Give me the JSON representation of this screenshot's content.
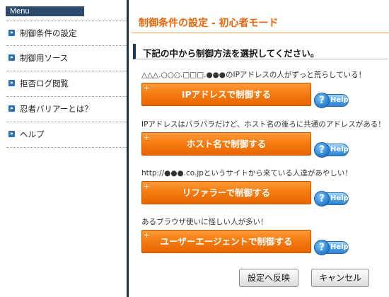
{
  "sidebar": {
    "header": "Menu",
    "items": [
      {
        "label": "制御条件の設定",
        "icon": "arrow-bullet-icon"
      },
      {
        "label": "制御用ソース",
        "icon": "arrow-bullet-icon"
      },
      {
        "label": "拒否ログ閲覧",
        "icon": "arrow-bullet-icon"
      },
      {
        "label": "忍者バリアーとは？",
        "icon": "arrow-bullet-icon"
      },
      {
        "label": "ヘルプ",
        "icon": "arrow-bullet-icon"
      }
    ]
  },
  "main": {
    "title": "制御条件の設定 - 初心者モード",
    "section_heading": "下記の中から制御方法を選択してください。",
    "options": [
      {
        "description": "△△△.○○○.□□□.●●●のIPアドレスの人がずっと荒らしている！",
        "button": "IPアドレスで制御する",
        "help": "Help"
      },
      {
        "description": "IPアドレスはバラバラだけど、ホスト名の後ろに共通のアドレスがある！",
        "button": "ホスト名で制御する",
        "help": "Help"
      },
      {
        "description": "http://●●●.co.jpというサイトから来ている人達があやしい！",
        "button": "リファラーで制御する",
        "help": "Help"
      },
      {
        "description": "あるブラウザ使いに怪しい人が多い！",
        "button": "ユーザーエージェントで制御する",
        "help": "Help"
      }
    ],
    "footer": {
      "apply_label": "設定へ反映",
      "cancel_label": "キャンセル"
    }
  },
  "colors": {
    "accent": "#e8650a",
    "button_orange": "#f47d12",
    "sidebar_header": "#2c4a6b",
    "help_blue": "#2f86d6"
  }
}
